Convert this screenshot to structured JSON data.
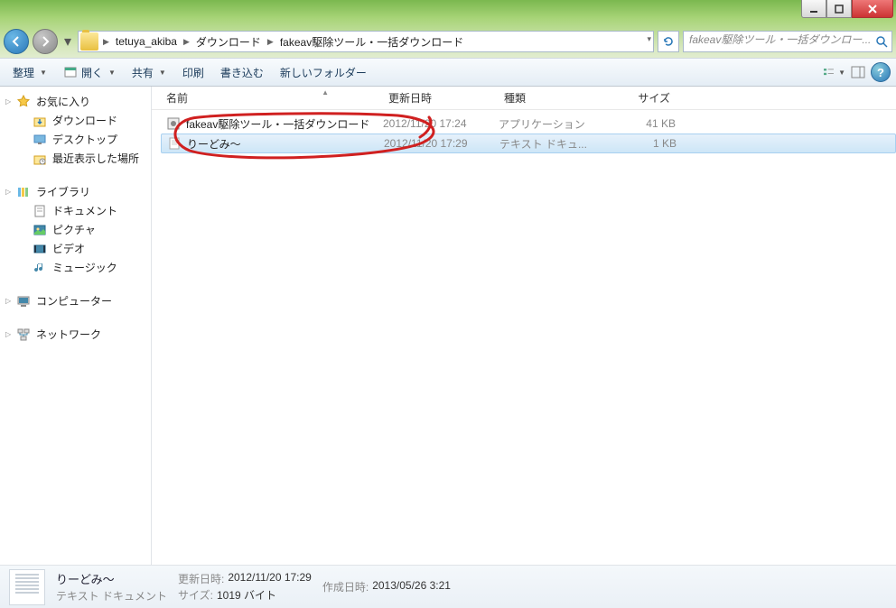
{
  "breadcrumb": {
    "segments": [
      "tetuya_akiba",
      "ダウンロード",
      "fakeav駆除ツール・一括ダウンロード"
    ]
  },
  "search": {
    "placeholder": "fakeav駆除ツール・一括ダウンロー..."
  },
  "toolbar": {
    "organize": "整理",
    "open": "開く",
    "share": "共有",
    "print": "印刷",
    "burn": "書き込む",
    "newfolder": "新しいフォルダー"
  },
  "sidebar": {
    "favorites": {
      "label": "お気に入り",
      "items": [
        "ダウンロード",
        "デスクトップ",
        "最近表示した場所"
      ]
    },
    "libraries": {
      "label": "ライブラリ",
      "items": [
        "ドキュメント",
        "ピクチャ",
        "ビデオ",
        "ミュージック"
      ]
    },
    "computer": {
      "label": "コンピューター"
    },
    "network": {
      "label": "ネットワーク"
    }
  },
  "columns": {
    "name": "名前",
    "date": "更新日時",
    "type": "種類",
    "size": "サイズ"
  },
  "files": [
    {
      "name": "fakeav駆除ツール・一括ダウンロード",
      "date": "2012/11/20 17:24",
      "type": "アプリケーション",
      "size": "41 KB",
      "icon": "app",
      "selected": false
    },
    {
      "name": "りーどみ～",
      "date": "2012/11/20 17:29",
      "type": "テキスト ドキュ...",
      "size": "1 KB",
      "icon": "txt",
      "selected": true
    }
  ],
  "details": {
    "name": "りーどみ～",
    "type": "テキスト ドキュメント",
    "modified_label": "更新日時:",
    "modified": "2012/11/20 17:29",
    "created_label": "作成日時:",
    "created": "2013/05/26 3:21",
    "size_label": "サイズ:",
    "size": "1019 バイト"
  }
}
